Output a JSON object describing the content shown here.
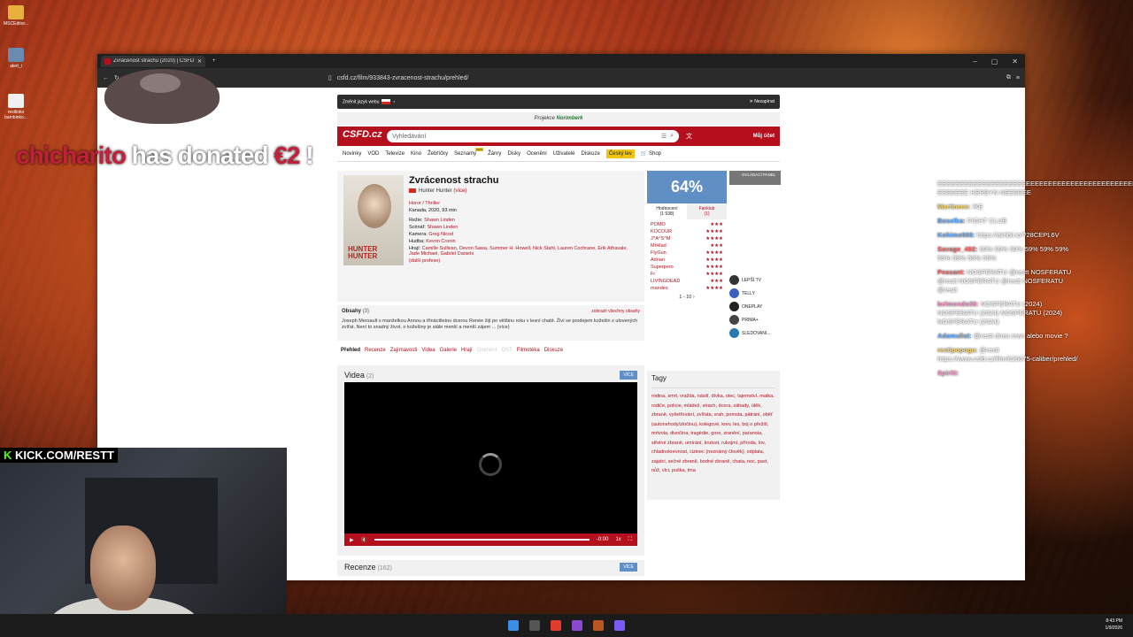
{
  "desktop": {
    "icons": [
      {
        "label": "MSCEditor..."
      },
      {
        "label": "alert_i"
      },
      {
        "label": "restlinko bambinko..."
      }
    ]
  },
  "browser": {
    "tab_title": "Zvrácenost strachu (2020) | ČSFD",
    "new_tab": "+",
    "url": "csfd.cz/film/933843-zvracenost-strachu/prehled/",
    "win_min": "–",
    "win_max": "▢",
    "win_close": "✕"
  },
  "site": {
    "lang_label": "Změnit jazyk webu",
    "close_label": "✕ Nezapínat",
    "promo_label": "Projekce",
    "promo_name": "Norimberk",
    "logo": "CSFD.cz",
    "search_placeholder": "Vyhledávání",
    "account": "Můj účet",
    "nav": [
      "Novinky",
      "VOD",
      "Televize",
      "Kino",
      "Žebříčky",
      "Seznamy",
      "Žánry",
      "Disky",
      "Ocenění",
      "Uživatelé",
      "Diskuze"
    ],
    "nav_highlight": "Český lev",
    "nav_shop": "🛒 Shop"
  },
  "film": {
    "title": "Zvrácenost strachu",
    "original_title": "Hunter Hunter",
    "more": "(více)",
    "genre": "Horor / Thriller",
    "meta": "Kanada, 2020, 93 min",
    "director_label": "Režie:",
    "director": "Shawn Linden",
    "writer_label": "Scénář:",
    "writer": "Shawn Linden",
    "camera_label": "Kamera:",
    "camera": "Greg Nicod",
    "music_label": "Hudba:",
    "music": "Kevon Cronin",
    "cast_label": "Hrají:",
    "cast": "Camille Sullivan, Devon Sawa, Summer H. Howell, Nick Stahl, Lauren Cochrane, Erik Athavale, Jade Michael, Gabriel Daniels",
    "more_prof": "(další profese)",
    "poster_title": "HUNTER HUNTER"
  },
  "rating": {
    "percent": "64%",
    "tab1": "Hodnocení",
    "tab1_count": "(1 938)",
    "tab2": "Fanklub",
    "tab2_count": "(1)",
    "rows": [
      {
        "user": "POMO",
        "stars": "★★★"
      },
      {
        "user": "KOCOUR",
        "stars": "★★★★"
      },
      {
        "user": "J^A^S^M",
        "stars": "★★★★"
      },
      {
        "user": "MrHlad",
        "stars": "★★★"
      },
      {
        "user": "FlyGun",
        "stars": "★★★★"
      },
      {
        "user": "Adrian",
        "stars": "★★★★"
      },
      {
        "user": "Superpero",
        "stars": "★★★★"
      },
      {
        "user": "Fr",
        "stars": "★★★★"
      },
      {
        "user": "LIVINGDEAD",
        "stars": "★★★"
      },
      {
        "user": "mandes",
        "stars": "★★★★"
      }
    ],
    "pager": "1 - 10 ›"
  },
  "side": {
    "panel": "OVLÁDACÍ PANEL",
    "streams": [
      "LEPŠÍ.TV",
      "TELLY",
      "ONEPLAY",
      "PRIMA+",
      "SLEDOVANI..."
    ]
  },
  "plot": {
    "title": "Obsahy",
    "count": "(3)",
    "all": "zobrazit všechny obsahy",
    "text": "Joseph Mersault s manželkou Annou a třináctiletou dcerou Renée žijí po většinu roku v lesní chatě. Živí se prodejem kožešin z ulovených zvířat. Není to snadný život, o kožešiny je stále menší a menší zájem ... (více)"
  },
  "tabs": [
    "Přehled",
    "Recenze",
    "Zajímavosti",
    "Videa",
    "Galerie",
    "Hrají",
    "Ocenění",
    "OST",
    "Filmotéka",
    "Diskuze"
  ],
  "videos": {
    "title": "Videa",
    "count": "(2)",
    "more": "VÍCE",
    "time": "-0:00",
    "speed": "1x"
  },
  "reviews": {
    "title": "Recenze",
    "count": "(162)",
    "more": "VÍCE"
  },
  "tags": {
    "title": "Tagy",
    "text": "rodina, smrt, vražda, násilí, dívka, otec, tajemství, matka, rodiče, policie, mládež, strach, dcera, záhady, útěk, zbraně, vyšetřování, zvířata, vrah, pomsta, pátrání, oběť (autonehody/zločinu), kolegové, krev, les, boj o přežití, mrtvola, divočina, tragédie, gore, zranění, paranoia, střelné zbraně, umírání, krutost, rukojmí, příroda, lov, chladnokrevnost, cizinec (neznámý člověk), odplata, zajatci, sečné zbraně, bodné zbraně, chata, noc, past, nůž, vlci, puška, tma"
  },
  "overlay": {
    "donor": "chicharito",
    "donate_mid": " has donated ",
    "amount": "€2",
    "donate_end": " !",
    "kick": "KICK.COM/RESTT"
  },
  "chat": [
    {
      "user": "",
      "text": "EEEEEEEEEEEEEEEEEEEEEEEEEEEEEEEEEEEEEEEEEEEEEEEEE EEEEEEE HERBYN NEEEEEE"
    },
    {
      "user": "Martineee:",
      "text": "ЖЕ"
    },
    {
      "user": "Boselko:",
      "text": "FIGHT CLUB"
    },
    {
      "user": "Kohime666:",
      "text": "https://aktibli.io/?28CEPL6V"
    },
    {
      "user": "Savage_492:",
      "text": "59% 59% 59% 59% 59% 59% 59% 59% 59% 59%"
    },
    {
      "user": "Peasant:",
      "text": "NOSFERATU @restt NOSFERATU @restt NOSFERATU @restt NOSFERATU @restt"
    },
    {
      "user": "belmondo36:",
      "text": "NOSFERATU (2024) NOSFERATU (2024) NOSFERATU (2024) NOSFERATU (2024)"
    },
    {
      "user": "Adamulist:",
      "text": "@restt dnes mwc alebo movie ?"
    },
    {
      "user": "restipopoga:",
      "text": "@restt https://www.csfd.cz/film/626675-caliber/prehled/"
    },
    {
      "user": "Spiritt:",
      "text": ""
    }
  ],
  "clock": {
    "time": "8:43 PM",
    "date": "1/9/2026"
  },
  "colors": {
    "accent": "#b50f1e",
    "rating": "#5f8fc4",
    "kick": "#53fc18"
  }
}
